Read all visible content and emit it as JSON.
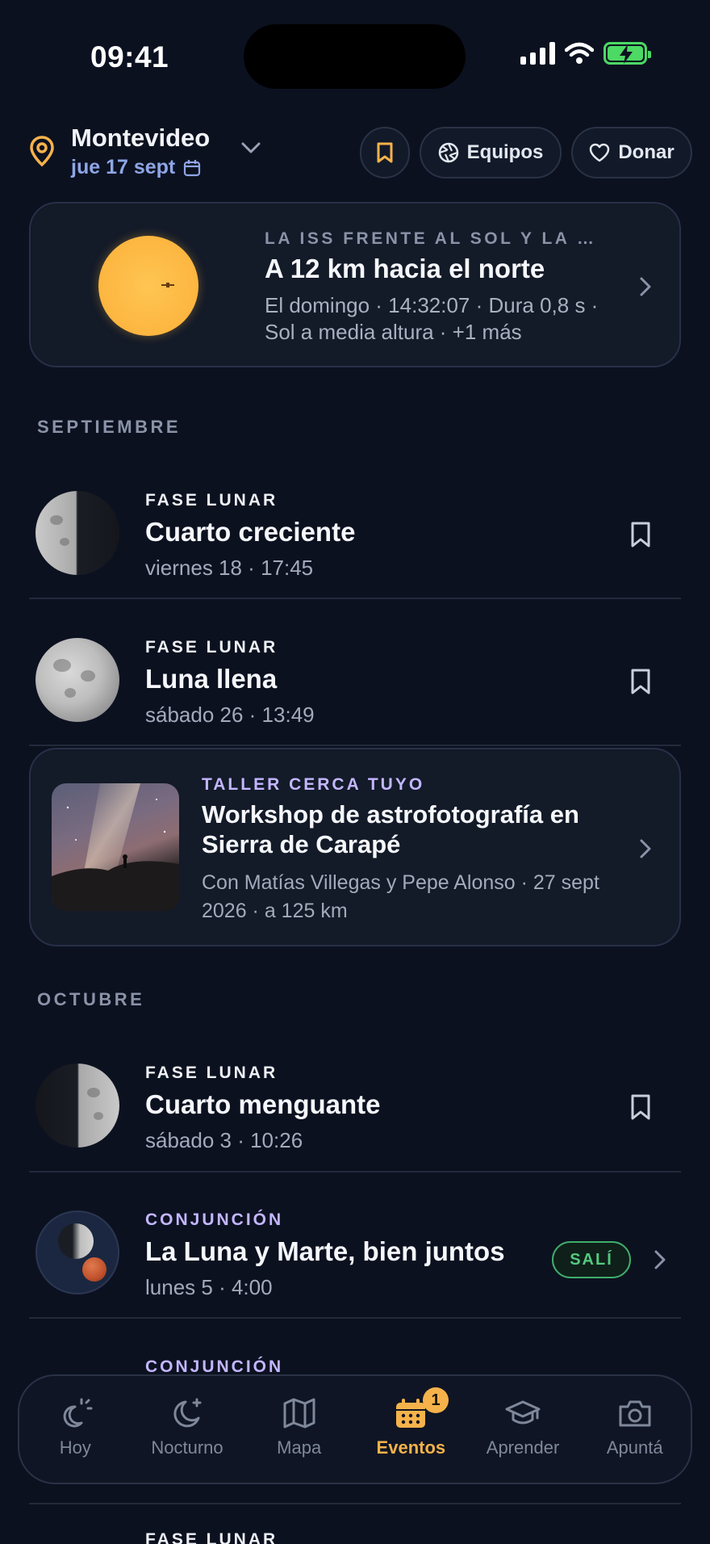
{
  "status": {
    "time": "09:41"
  },
  "header": {
    "city": "Montevideo",
    "date": "jue 17 sept",
    "equipos_label": "Equipos",
    "donar_label": "Donar"
  },
  "iss": {
    "eyebrow": "LA ISS FRENTE AL SOL Y LA …",
    "title": "A 12 km hacia el norte",
    "subtitle": "El domingo · 14:32:07 · Dura 0,8 s · Sol a media altura · +1 más"
  },
  "months": {
    "september": "SEPTIEMBRE",
    "october": "OCTUBRE"
  },
  "events": [
    {
      "eyebrow": "FASE LUNAR",
      "title": "Cuarto creciente",
      "when": "viernes 18 · 17:45"
    },
    {
      "eyebrow": "FASE LUNAR",
      "title": "Luna llena",
      "when": "sábado 26 · 13:49"
    },
    {
      "eyebrow": "FASE LUNAR",
      "title": "Cuarto menguante",
      "when": "sábado 3 · 10:26"
    },
    {
      "eyebrow": "CONJUNCIÓN",
      "title": "La Luna y Marte, bien juntos",
      "when": "lunes 5 · 4:00",
      "badge": "SALÍ"
    },
    {
      "eyebrow": "CONJUNCIÓN"
    },
    {
      "eyebrow": "FASE LUNAR"
    }
  ],
  "workshop": {
    "eyebrow": "TALLER CERCA TUYO",
    "title": "Workshop de astrofotografía en Sierra de Carapé",
    "subtitle": "Con Matías Villegas y Pepe Alonso · 27 sept 2026 · a 125 km"
  },
  "tabs": [
    {
      "label": "Hoy",
      "icon": "sun-moon-icon"
    },
    {
      "label": "Nocturno",
      "icon": "moon-star-icon"
    },
    {
      "label": "Mapa",
      "icon": "map-icon"
    },
    {
      "label": "Eventos",
      "icon": "calendar-icon",
      "badge": "1",
      "active": true
    },
    {
      "label": "Aprender",
      "icon": "graduation-cap-icon"
    },
    {
      "label": "Apuntá",
      "icon": "camera-icon"
    }
  ],
  "colors": {
    "background": "#0c1120",
    "accent": "#f6b24a",
    "conjunction": "#c3b6ff",
    "success": "#54c97f"
  }
}
